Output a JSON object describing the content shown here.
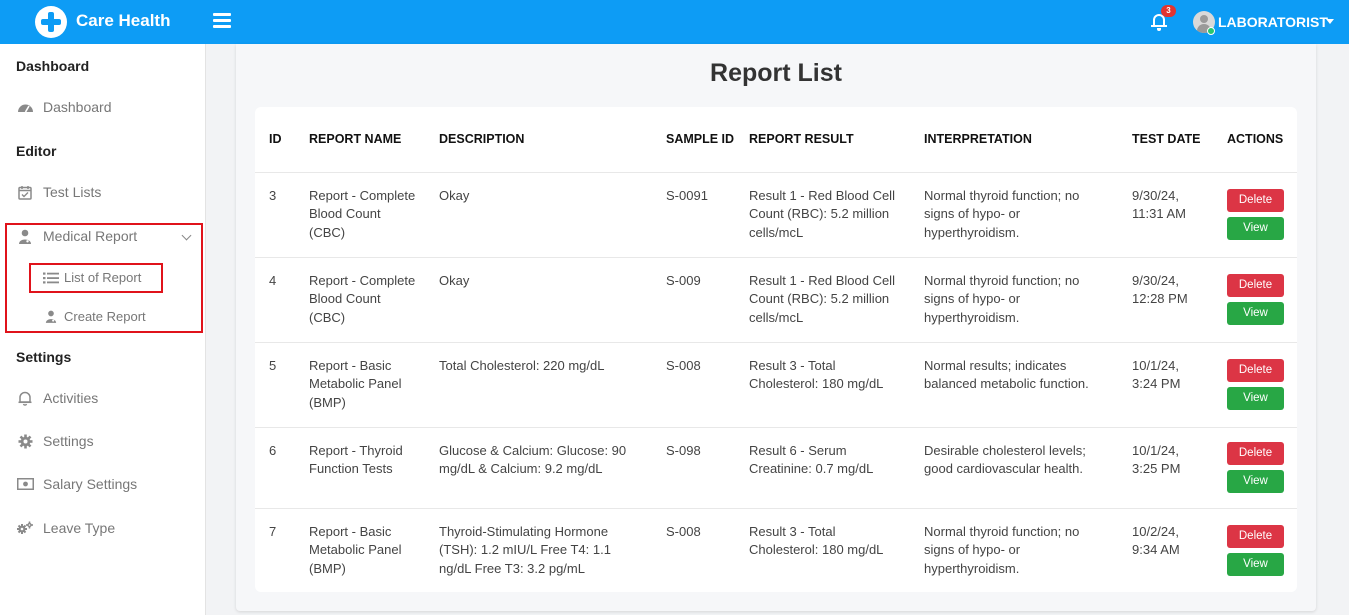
{
  "app": {
    "brand": "Care Health"
  },
  "header": {
    "notification_count": "3",
    "user_name": "LABORATORIST"
  },
  "sidebar": {
    "section_dashboard": "Dashboard",
    "item_dashboard": "Dashboard",
    "section_editor": "Editor",
    "item_test_lists": "Test Lists",
    "item_medical_report": "Medical Report",
    "sub_list_of_report": "List of Report",
    "sub_create_report": "Create Report",
    "section_settings": "Settings",
    "item_activities": "Activities",
    "item_settings": "Settings",
    "item_salary_settings": "Salary Settings",
    "item_leave_type": "Leave Type"
  },
  "page": {
    "title": "Report List"
  },
  "table": {
    "headers": {
      "id": "ID",
      "report_name": "REPORT NAME",
      "description": "DESCRIPTION",
      "sample_id": "SAMPLE ID",
      "report_result": "REPORT RESULT",
      "interpretation": "INTERPRETATION",
      "test_date": "TEST DATE",
      "actions": "ACTIONS"
    },
    "actions": {
      "delete_label": "Delete",
      "view_label": "View"
    },
    "rows": [
      {
        "id": "3",
        "report_name": "Report - Complete Blood Count (CBC)",
        "description": "Okay",
        "sample_id": "S-0091",
        "report_result": "Result 1 - Red Blood Cell Count (RBC): 5.2 million cells/mcL",
        "interpretation": "Normal thyroid function; no signs of hypo- or hyperthyroidism.",
        "test_date": "9/30/24, 11:31 AM"
      },
      {
        "id": "4",
        "report_name": "Report - Complete Blood Count (CBC)",
        "description": "Okay",
        "sample_id": "S-009",
        "report_result": "Result 1 - Red Blood Cell Count (RBC): 5.2 million cells/mcL",
        "interpretation": "Normal thyroid function; no signs of hypo- or hyperthyroidism.",
        "test_date": "9/30/24, 12:28 PM"
      },
      {
        "id": "5",
        "report_name": "Report - Basic Metabolic Panel (BMP)",
        "description": "Total Cholesterol: 220 mg/dL",
        "sample_id": "S-008",
        "report_result": "Result 3 - Total Cholesterol: 180 mg/dL",
        "interpretation": "Normal results; indicates balanced metabolic function.",
        "test_date": "10/1/24, 3:24 PM"
      },
      {
        "id": "6",
        "report_name": "Report - Thyroid Function Tests",
        "description": "Glucose & Calcium: Glucose: 90 mg/dL & Calcium: 9.2 mg/dL",
        "sample_id": "S-098",
        "report_result": "Result 6 - Serum Creatinine: 0.7 mg/dL",
        "interpretation": "Desirable cholesterol levels; good cardiovascular health.",
        "test_date": "10/1/24, 3:25 PM"
      },
      {
        "id": "7",
        "report_name": "Report - Basic Metabolic Panel (BMP)",
        "description": "Thyroid-Stimulating Hormone (TSH): 1.2 mIU/L Free T4: 1.1 ng/dL Free T3: 3.2 pg/mL",
        "sample_id": "S-008",
        "report_result": "Result 3 - Total Cholesterol: 180 mg/dL",
        "interpretation": "Normal thyroid function; no signs of hypo- or hyperthyroidism.",
        "test_date": "10/2/24, 9:34 AM"
      }
    ]
  },
  "colors": {
    "topbar": "#0d9cf5",
    "delete": "#dc3545",
    "view": "#28a745",
    "highlight": "#e0131b"
  },
  "icons": {
    "logo": "medical-cross-icon",
    "menu": "hamburger-icon",
    "notifications": "bell-icon",
    "user": "avatar-icon"
  }
}
